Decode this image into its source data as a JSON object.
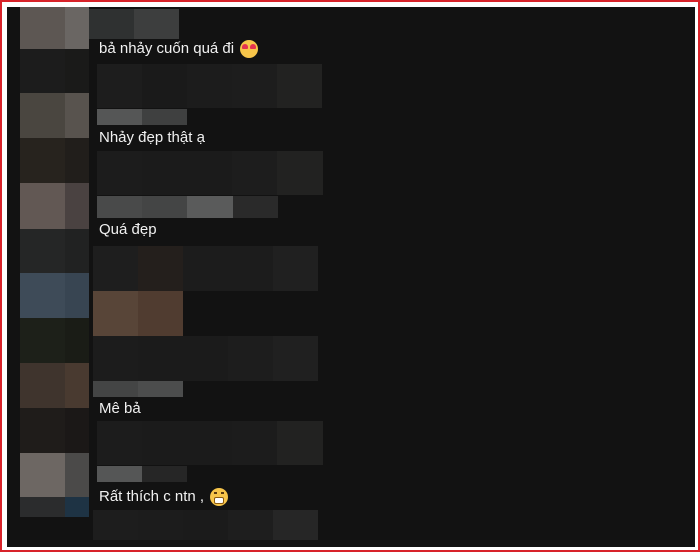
{
  "comments": [
    {
      "text": "bả nhảy cuốn quá đi",
      "emoji": "smiling-face-with-hearts-icon"
    },
    {
      "text": "Nhảy đẹp thật ạ"
    },
    {
      "text": "Quá đẹp"
    },
    {
      "text": "Mê bả"
    },
    {
      "text": "Rất thích c ntn ,",
      "emoji": "grinning-face-icon"
    }
  ],
  "colors": {
    "background": "#121212",
    "text": "#f1f1f1",
    "frame_border": "#d8232a"
  }
}
